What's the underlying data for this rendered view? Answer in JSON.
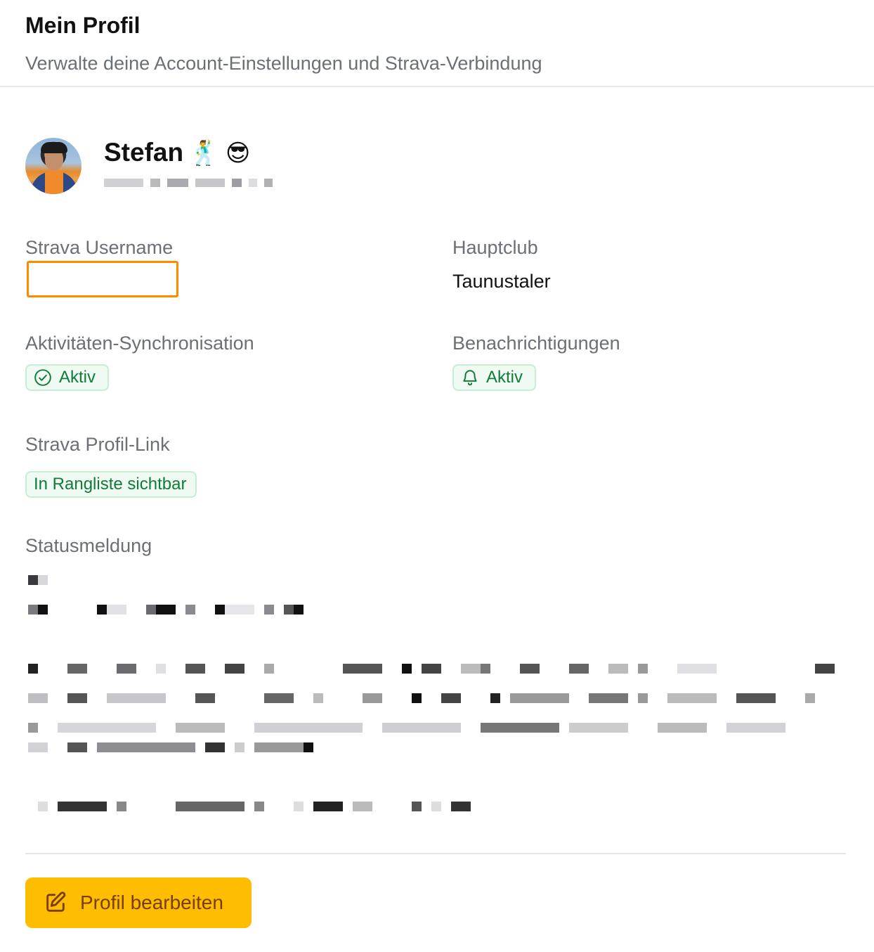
{
  "header": {
    "title": "Mein Profil",
    "subtitle": "Verwalte deine Account-Einstellungen und Strava-Verbindung"
  },
  "profile": {
    "name": "Stefan",
    "name_emojis": "🕺 😎",
    "avatar_icon": "user-avatar-photo"
  },
  "fields": {
    "strava_username_label": "Strava Username",
    "strava_username_value": "",
    "hauptclub_label": "Hauptclub",
    "hauptclub_value": "Taunustaler",
    "sync_label": "Aktivitäten-Synchronisation",
    "sync_badge": "Aktiv",
    "sync_icon": "check-circle-icon",
    "notifications_label": "Benachrichtigungen",
    "notifications_badge": "Aktiv",
    "notifications_icon": "bell-icon",
    "profile_link_label": "Strava Profil-Link",
    "profile_link_badge": "In Rangliste sichtbar",
    "status_label": "Statusmeldung"
  },
  "actions": {
    "edit_label": "Profil bearbeiten",
    "edit_icon": "pencil-square-icon"
  },
  "colors": {
    "accent_button": "#ffbd00",
    "badge_green": "#127a3a",
    "highlight_orange": "#ff8a00"
  }
}
